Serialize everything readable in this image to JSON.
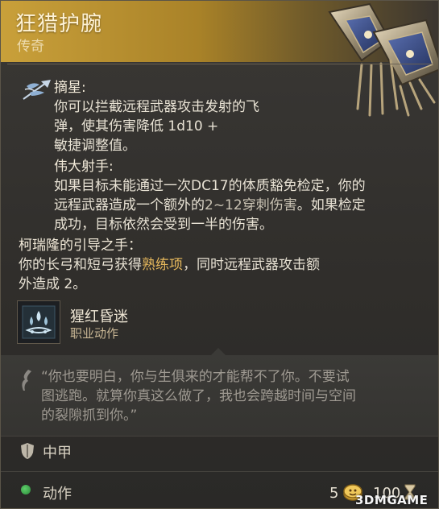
{
  "item": {
    "name": "狂猎护腕",
    "rarity": "传奇"
  },
  "abilities": {
    "zhaixing": {
      "title": "摘星:",
      "line1": "你可以拦截远程武器攻击发射的飞",
      "line2": "弹，使其伤害降低 1d10 +",
      "line3": "敏捷调整值。"
    },
    "weida": {
      "title": "伟大射手:",
      "line1": "如果目标未能通过一次DC17的体质豁免检定，你的",
      "line2_a": "远程武器造成一个额外的",
      "line2_b": "2~12穿刺伤害",
      "line2_c": "。如果检定",
      "line3": "成功，目标依然会受到一半的伤害。"
    },
    "kerui": {
      "title": "柯瑞隆的引导之手：",
      "line1_a": "你的长弓和短弓获得",
      "line1_b": "熟练项",
      "line1_c": "，同时远程武器攻击额",
      "line2": "外造成 2。"
    }
  },
  "action": {
    "name": "猩红昏迷",
    "type": "职业动作"
  },
  "quote": {
    "line1": "“你也要明白，你与生俱来的才能帮不了你。不要试",
    "line2": "图逃跑。就算你真这么做了，我也会跨越时间与空间",
    "line3": "的裂隙抓到你。”"
  },
  "footer": {
    "armor": "中甲",
    "action_label": "动作",
    "weight": "5",
    "price": "100"
  },
  "watermark": "3DMGAME",
  "colors": {
    "header_gold": "#c9a03a",
    "highlight": "#e6b85c",
    "quote_text": "#9e9991",
    "action_dot": "#3fae4d"
  },
  "icons": {
    "ability": "winged-arrow-icon",
    "action": "crimson-droplets-icon",
    "quote": "quill-icon",
    "armor": "shield-icon",
    "action_dot": "green-dot-icon",
    "gold": "gold-coin-icon",
    "price": "hourglass-icon"
  }
}
